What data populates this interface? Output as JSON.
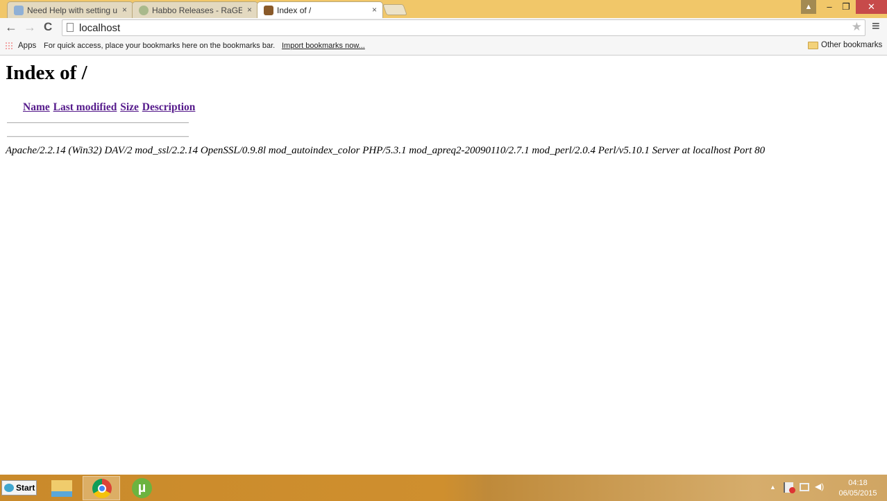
{
  "browser": {
    "tabs": [
      {
        "title": "Need Help with setting up",
        "active": false,
        "close": "×"
      },
      {
        "title": "Habbo Releases - RaGEZONE",
        "active": false,
        "close": "×"
      },
      {
        "title": "Index of /",
        "active": true,
        "close": "×"
      }
    ],
    "window_controls": {
      "minimize": "–",
      "restore": "❐",
      "close": "✕"
    },
    "nav": {
      "back": "←",
      "forward": "→",
      "reload": "C"
    },
    "address": "localhost",
    "menu_icon": "≡",
    "star_icon": "★",
    "bookmarks": {
      "apps": "Apps",
      "hint": "For quick access, place your bookmarks here on the bookmarks bar.",
      "import": "Import bookmarks now...",
      "other": "Other bookmarks"
    }
  },
  "page": {
    "title": "Index of /",
    "columns": [
      "Name",
      "Last modified",
      "Size",
      "Description"
    ],
    "server_signature": "Apache/2.2.14 (Win32) DAV/2 mod_ssl/2.2.14 OpenSSL/0.9.8l mod_autoindex_color PHP/5.3.1 mod_apreq2-20090110/2.7.1 mod_perl/2.0.4 Perl/v5.10.1 Server at localhost Port 80",
    "link_color": "#551a8b"
  },
  "taskbar": {
    "start": "Start",
    "apps": [
      "file-explorer-icon",
      "chrome-icon",
      "utorrent-icon"
    ],
    "clock": {
      "time": "04:18",
      "date": "06/05/2015"
    }
  }
}
